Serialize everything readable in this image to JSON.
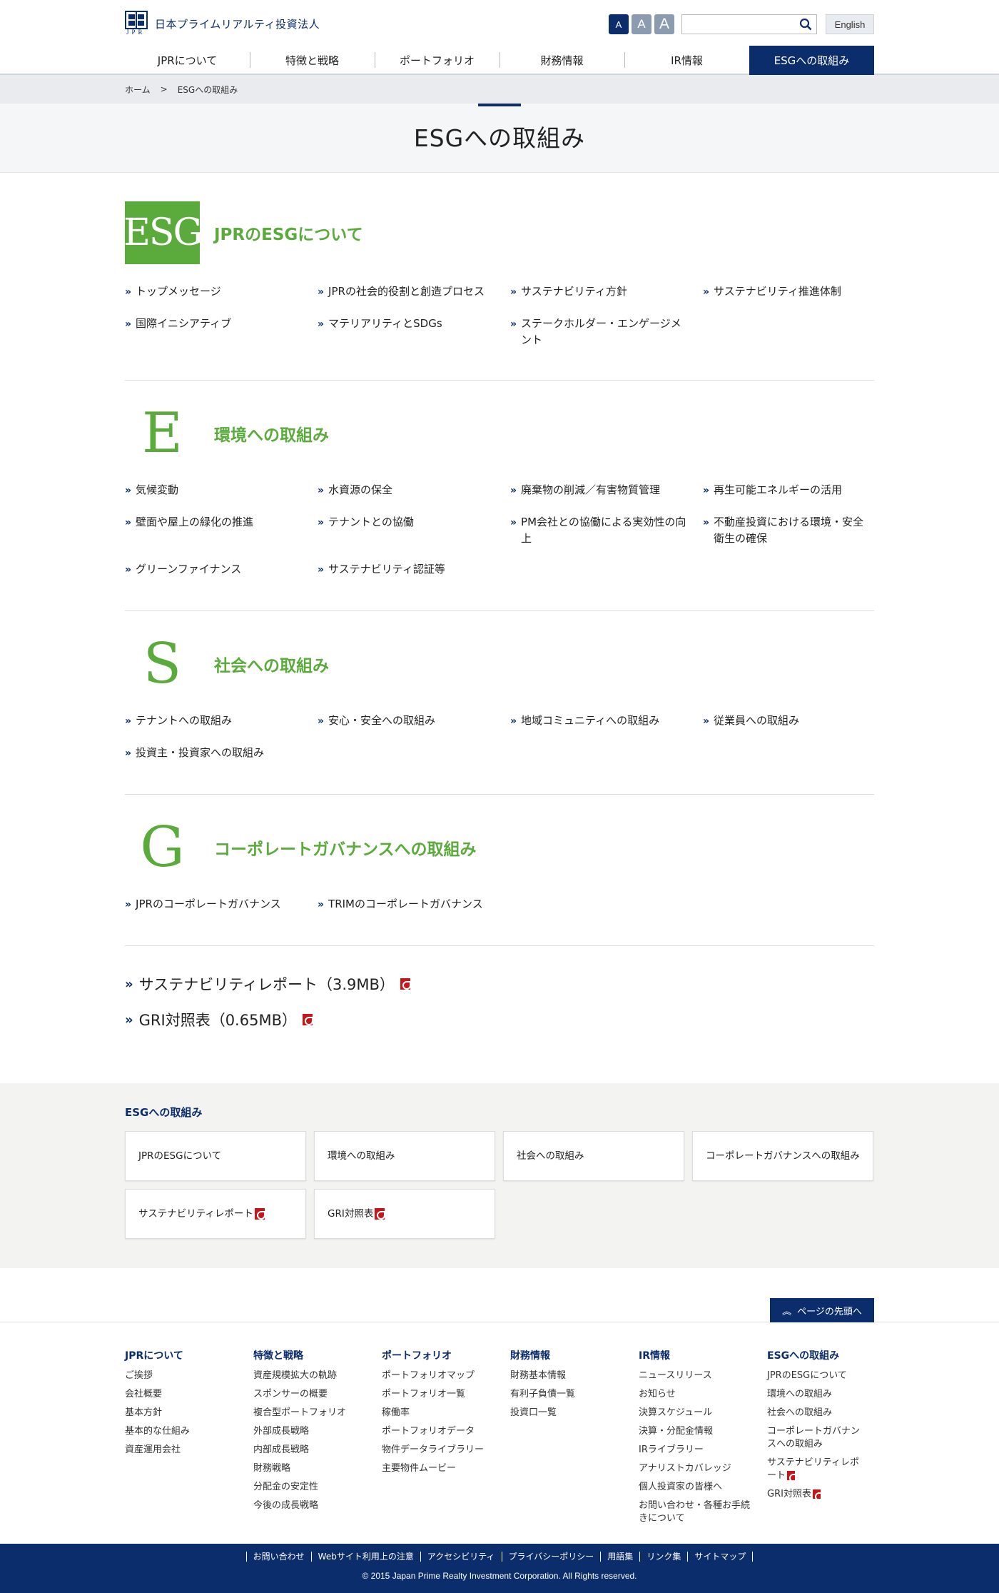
{
  "header": {
    "logo_text": "日本プライムリアルティ投資法人",
    "logo_sub": "JPR",
    "font_small": "A",
    "font_medium": "A",
    "font_large": "A",
    "search_placeholder": "",
    "english_label": "English"
  },
  "gnav": [
    "JPRについて",
    "特徴と戦略",
    "ポートフォリオ",
    "財務情報",
    "IR情報",
    "ESGへの取組み"
  ],
  "breadcrumb": {
    "home": "ホーム",
    "sep": ">",
    "current": "ESGへの取組み"
  },
  "page_title": "ESGへの取組み",
  "sections": [
    {
      "badge": "ESG",
      "title": "JPRのESGについて",
      "links": [
        "トップメッセージ",
        "JPRの社会的役割と創造プロセス",
        "サステナビリティ方針",
        "サステナビリティ推進体制",
        "国際イニシアティブ",
        "マテリアリティとSDGs",
        "ステークホルダー・エンゲージメント"
      ]
    },
    {
      "badge": "E",
      "title": "環境への取組み",
      "links": [
        "気候変動",
        "水資源の保全",
        "廃棄物の削減／有害物質管理",
        "再生可能エネルギーの活用",
        "壁面や屋上の緑化の推進",
        "テナントとの協働",
        "PM会社との協働による実効性の向上",
        "不動産投資における環境・安全衛生の確保",
        "グリーンファイナンス",
        "サステナビリティ認証等"
      ]
    },
    {
      "badge": "S",
      "title": "社会への取組み",
      "links": [
        "テナントへの取組み",
        "安心・安全への取組み",
        "地域コミュニティへの取組み",
        "従業員への取組み",
        "投資主・投資家への取組み"
      ]
    },
    {
      "badge": "G",
      "title": "コーポレートガバナンスへの取組み",
      "links": [
        "JPRのコーポレートガバナンス",
        "TRIMのコーポレートガバナンス"
      ]
    }
  ],
  "arrow_glyph": "»",
  "reports": [
    "サステナビリティレポート（3.9MB）",
    "GRI対照表（0.65MB）"
  ],
  "localnav": {
    "title": "ESGへの取組み",
    "cards": [
      "JPRのESGについて",
      "環境への取組み",
      "社会への取組み",
      "コーポレートガバナンスへの取組み",
      "サステナビリティレポート",
      "GRI対照表"
    ]
  },
  "pagetop": {
    "chevron": "︽",
    "label": "ページの先頭へ"
  },
  "footer_nav": [
    {
      "title": "JPRについて",
      "items": [
        "ご挨拶",
        "会社概要",
        "基本方針",
        "基本的な仕組み",
        "資産運用会社"
      ]
    },
    {
      "title": "特徴と戦略",
      "items": [
        "資産規模拡大の軌跡",
        "スポンサーの概要",
        "複合型ポートフォリオ",
        "外部成長戦略",
        "内部成長戦略",
        "財務戦略",
        "分配金の安定性",
        "今後の成長戦略"
      ]
    },
    {
      "title": "ポートフォリオ",
      "items": [
        "ポートフォリオマップ",
        "ポートフォリオ一覧",
        "稼働率",
        "ポートフォリオデータ",
        "物件データライブラリー",
        "主要物件ムービー"
      ]
    },
    {
      "title": "財務情報",
      "items": [
        "財務基本情報",
        "有利子負債一覧",
        "投資口一覧"
      ]
    },
    {
      "title": "IR情報",
      "items": [
        "ニュースリリース",
        "お知らせ",
        "決算スケジュール",
        "決算・分配金情報",
        "IRライブラリー",
        "アナリストカバレッジ",
        "個人投資家の皆様へ",
        "お問い合わせ・各種お手続きについて"
      ]
    },
    {
      "title": "ESGへの取組み",
      "items": [
        "JPRのESGについて",
        "環境への取組み",
        "社会への取組み",
        "コーポレートガバナンスへの取組み",
        "サステナビリティレポート",
        "GRI対照表"
      ]
    }
  ],
  "footer_links": [
    "お問い合わせ",
    "Webサイト利用上の注意",
    "アクセシビリティ",
    "プライバシーポリシー",
    "用語集",
    "リンク集",
    "サイトマップ"
  ],
  "copyright": "© 2015 Japan Prime Realty Investment Corporation. All Rights reserved.",
  "colors": {
    "navy": "#0b2d6b",
    "green": "#5aaa3c",
    "pdf_red": "#c6161c"
  }
}
